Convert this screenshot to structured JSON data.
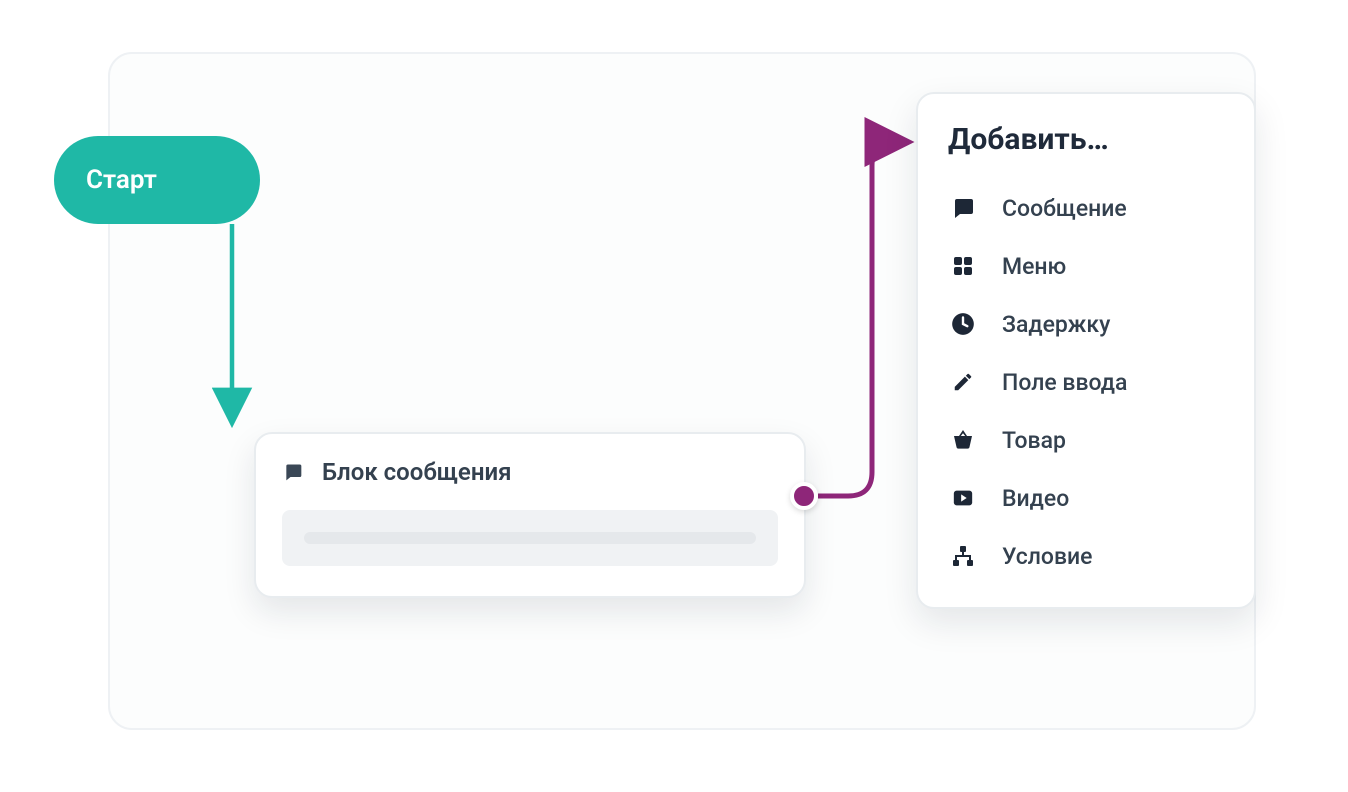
{
  "colors": {
    "start_node": "#1fb8a6",
    "connector_teal": "#1fb8a6",
    "connector_purple": "#8e2679",
    "text_dark": "#1f2a3a",
    "text_body": "#34414f"
  },
  "start": {
    "label": "Старт"
  },
  "message_block": {
    "title": "Блок сообщения",
    "icon": "message-icon"
  },
  "add_panel": {
    "title": "Добавить…",
    "items": [
      {
        "icon": "message-icon",
        "label": "Сообщение"
      },
      {
        "icon": "grid-icon",
        "label": "Меню"
      },
      {
        "icon": "clock-icon",
        "label": "Задержку"
      },
      {
        "icon": "pencil-icon",
        "label": "Поле ввода"
      },
      {
        "icon": "basket-icon",
        "label": "Товар"
      },
      {
        "icon": "video-icon",
        "label": "Видео"
      },
      {
        "icon": "sitemap-icon",
        "label": "Условие"
      }
    ]
  }
}
